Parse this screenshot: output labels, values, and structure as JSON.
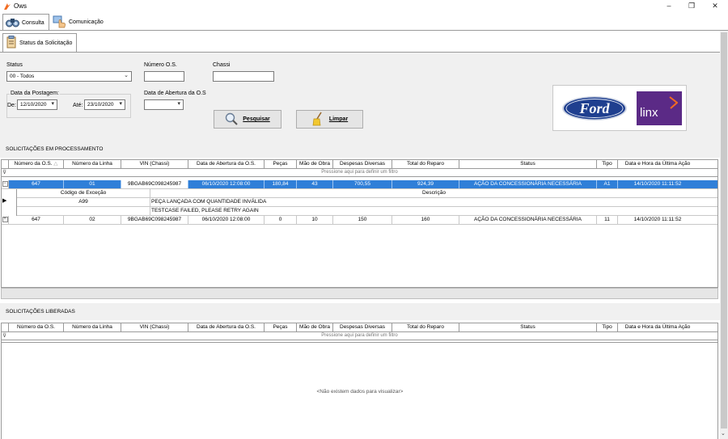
{
  "window": {
    "title": "Ows",
    "minimize": "–",
    "maximize": "❐",
    "close": "✕"
  },
  "tabs": [
    {
      "label": "Consulta"
    },
    {
      "label": "Comunicação"
    }
  ],
  "subtab": {
    "label": "Status da Solicitação"
  },
  "filters": {
    "status_label": "Status",
    "status_value": "00 - Todos",
    "numero_os_label": "Número O.S.",
    "numero_os_value": "",
    "chassi_label": "Chassi",
    "chassi_value": "",
    "data_postagem_label": "Data da Postagem:",
    "de_label": "De:",
    "de_value": "12/10/2020",
    "ate_label": "Até:",
    "ate_value": "23/10/2020",
    "data_abertura_label": "Data de Abertura da O.S",
    "data_abertura_value": ""
  },
  "buttons": {
    "pesquisar": "Pesquisar",
    "limpar": "Limpar"
  },
  "logos": {
    "ford": "Ford",
    "linx": "linx"
  },
  "processing": {
    "title": "SOLICITAÇÕES EM PROCESSAMENTO",
    "columns": [
      "Número da O.S.",
      "Número da Linha",
      "VIN (Chassi)",
      "Data de Abertura da O.S.",
      "Peças",
      "Mão de Obra",
      "Despesas Diversas",
      "Total do Reparo",
      "Status",
      "Tipo",
      "Data e Hora da Última Ação"
    ],
    "filter_hint": "Pressione aqui para definir um filtro",
    "rows": [
      {
        "os": "647",
        "linha": "01",
        "vin": "9BGAB69C098245987",
        "abertura": "06/10/2020 12:08:00",
        "pecas": "180,84",
        "mao": "43",
        "despesas": "700,55",
        "total": "924,39",
        "status": "AÇÃO DA CONCESSIONÁRIA NECESSÁRIA",
        "tipo": "A1",
        "ultima": "14/10/2020 11:11:52"
      },
      {
        "os": "647",
        "linha": "02",
        "vin": "9BGAB69C098245987",
        "abertura": "06/10/2020 12:08:00",
        "pecas": "0",
        "mao": "10",
        "despesas": "150",
        "total": "160",
        "status": "AÇÃO DA CONCESSIONÁRIA NECESSÁRIA",
        "tipo": "11",
        "ultima": "14/10/2020 11:11:52"
      }
    ],
    "detail": {
      "columns": [
        "Código de Exceção",
        "Descrição"
      ],
      "rows": [
        {
          "codigo": "A99",
          "descricao": "PEÇA LANÇADA COM QUANTIDADE INVÁLIDA"
        },
        {
          "codigo": "",
          "descricao": "TESTCASE  FAILED, PLEASE RETRY AGAIN"
        }
      ]
    }
  },
  "released": {
    "title": "SOLICITAÇÕES LIBERADAS",
    "columns": [
      "Número da O.S.",
      "Número da Linha",
      "VIN (Chassi)",
      "Data de Abertura da O.S.",
      "Peças",
      "Mão de Obra",
      "Despesas Diversas",
      "Total do Reparo",
      "Status",
      "Tipo",
      "Data e Hora da Última Ação"
    ],
    "filter_hint": "Pressione aqui para definir um filtro",
    "empty_message": "<Não existem dados para visualizar>"
  },
  "colors": {
    "selection": "#2f7fd8",
    "ford_blue": "#1f3f8f",
    "linx_purple": "#5b2a86",
    "linx_orange": "#f26b21"
  }
}
